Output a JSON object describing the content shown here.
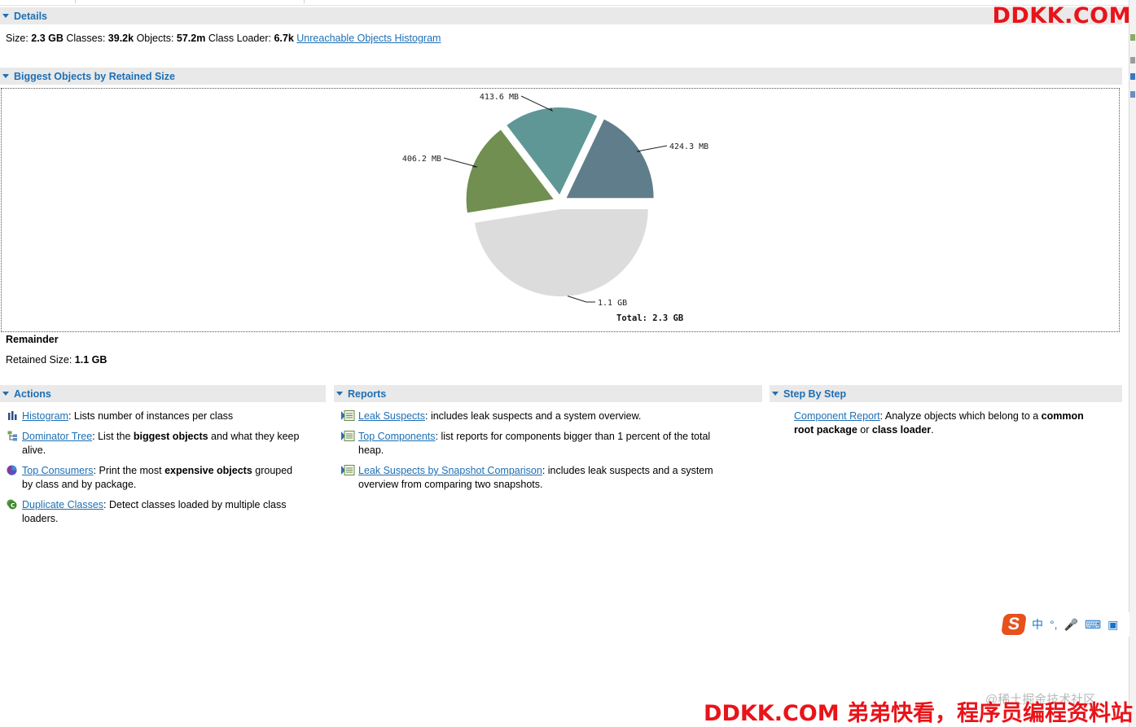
{
  "details": {
    "section_title": "Details",
    "size_label": "Size:",
    "size_value": "2.3 GB",
    "classes_label": "Classes:",
    "classes_value": "39.2k",
    "objects_label": "Objects:",
    "objects_value": "57.2m",
    "classloader_label": "Class Loader:",
    "classloader_value": "6.7k",
    "unreachable_link": "Unreachable Objects Histogram"
  },
  "biggest": {
    "section_title": "Biggest Objects by Retained Size",
    "selected_name": "Remainder",
    "retained_label": "Retained Size:",
    "retained_value": "1.1 GB"
  },
  "chart_data": {
    "type": "pie",
    "total_label": "Total: 2.3 GB",
    "slices": [
      {
        "label": "424.3 MB",
        "value": 424.3,
        "color": "#607d8b"
      },
      {
        "label": "413.6 MB",
        "value": 413.6,
        "color": "#5f9797"
      },
      {
        "label": "406.2 MB",
        "value": 406.2,
        "color": "#718f50"
      },
      {
        "label": "1.1 GB",
        "value": 1126.4,
        "color": "#dcdcdc"
      }
    ]
  },
  "actions": {
    "section_title": "Actions",
    "items": [
      {
        "link": "Histogram",
        "text1": ": Lists number of instances per class",
        "line2": ""
      },
      {
        "link": "Dominator Tree",
        "text1": ": List the ",
        "bold": "biggest objects",
        "text2": " and what they keep",
        "line2": "alive."
      },
      {
        "link": "Top Consumers",
        "text1": ": Print the most ",
        "bold": "expensive objects",
        "text2": " grouped",
        "line2": "by class and by package."
      },
      {
        "link": "Duplicate Classes",
        "text1": ": Detect classes loaded by multiple class",
        "line2": "loaders."
      }
    ]
  },
  "reports": {
    "section_title": "Reports",
    "items": [
      {
        "link": "Leak Suspects",
        "text1": ": includes leak suspects and a system overview.",
        "line2": ""
      },
      {
        "link": "Top Components",
        "text1": ": list reports for components bigger than 1 percent of the total",
        "line2": "heap."
      },
      {
        "link": "Leak Suspects by Snapshot Comparison",
        "text1": ": includes leak suspects and a system",
        "line2": "overview from comparing two snapshots."
      }
    ]
  },
  "stepbystep": {
    "section_title": "Step By Step",
    "link": "Component Report",
    "text1": ": Analyze objects which belong to a ",
    "bold1": "common",
    "bold2": "root package",
    "text2": " or ",
    "bold3": "class loader",
    "text3": "."
  },
  "watermarks": {
    "top": "DDKK.COM",
    "bottom": "DDKK.COM 弟弟快看，程序员编程资料站",
    "gray": "@稀土掘金技术社区"
  },
  "ime": {
    "logo": "S",
    "lang": "中",
    "punct": "°,"
  }
}
